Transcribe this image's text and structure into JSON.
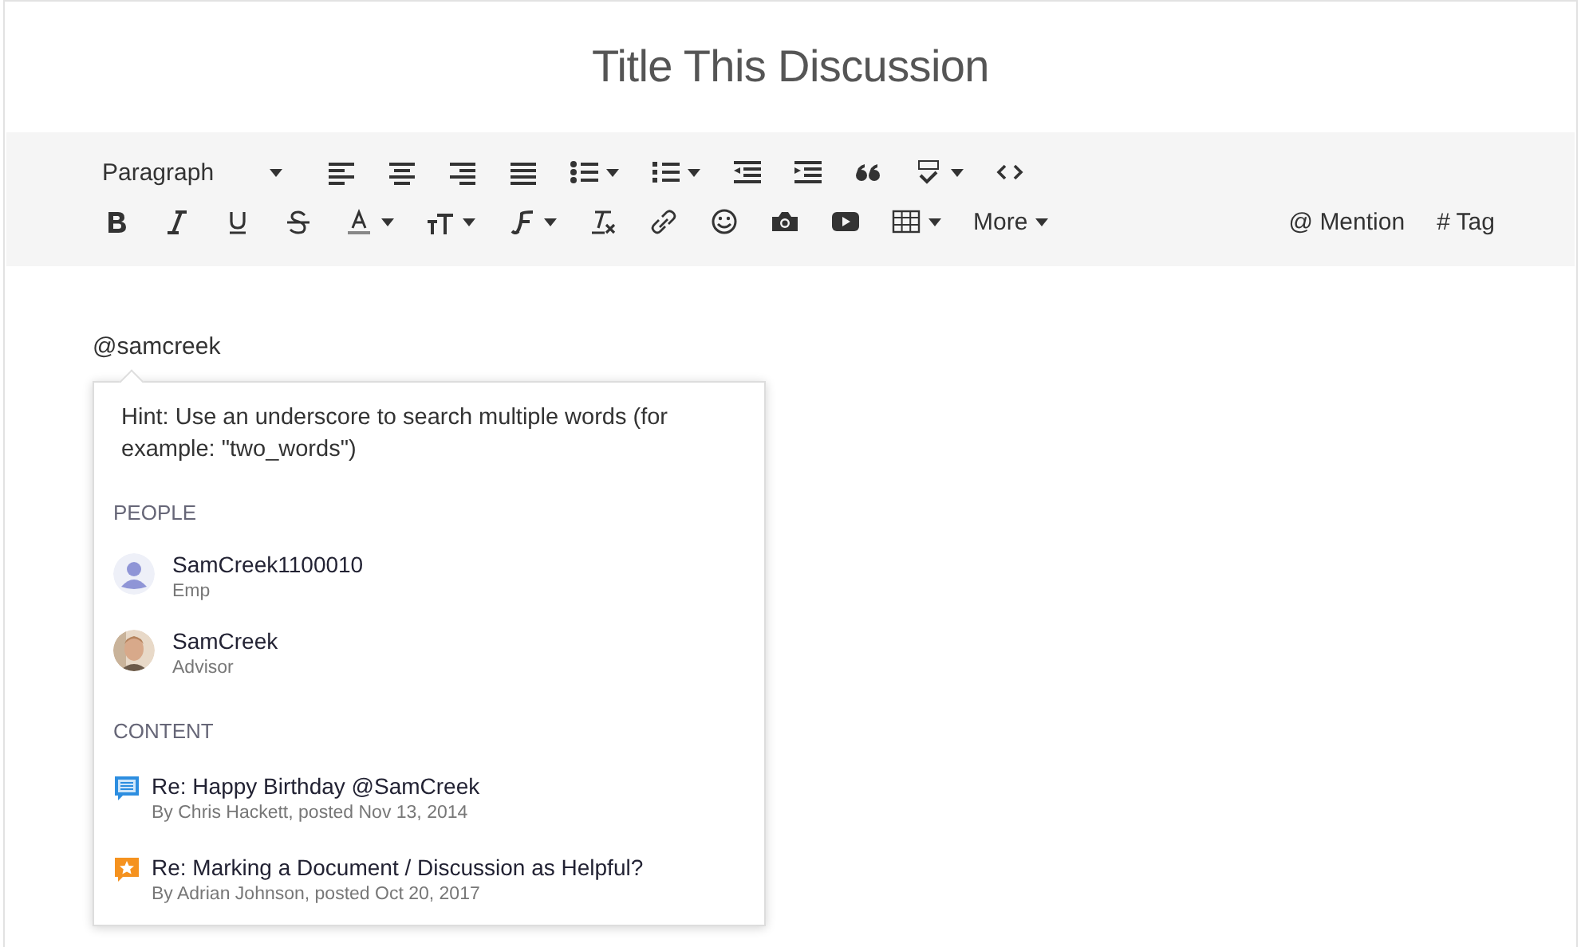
{
  "title": "Title This Discussion",
  "toolbar": {
    "rows": [
      [
        {
          "kind": "paragraph",
          "label": "Paragraph",
          "dropdown": true
        },
        {
          "kind": "align-left",
          "dropdown": false
        },
        {
          "kind": "align-center",
          "dropdown": false
        },
        {
          "kind": "align-right",
          "dropdown": false
        },
        {
          "kind": "justify",
          "dropdown": false
        },
        {
          "kind": "bullet-list",
          "dropdown": true
        },
        {
          "kind": "numbered-list",
          "dropdown": true
        },
        {
          "kind": "outdent",
          "dropdown": false
        },
        {
          "kind": "indent",
          "dropdown": false
        },
        {
          "kind": "quote",
          "dropdown": false
        },
        {
          "kind": "spellcheck",
          "dropdown": true
        },
        {
          "kind": "code",
          "dropdown": false
        }
      ],
      [
        {
          "kind": "bold",
          "dropdown": false
        },
        {
          "kind": "italic",
          "dropdown": false
        },
        {
          "kind": "underline",
          "dropdown": false
        },
        {
          "kind": "strike",
          "dropdown": false
        },
        {
          "kind": "text-color",
          "dropdown": true
        },
        {
          "kind": "font-size",
          "dropdown": true
        },
        {
          "kind": "font-family",
          "dropdown": true
        },
        {
          "kind": "clear-format",
          "dropdown": false
        },
        {
          "kind": "link",
          "dropdown": false
        },
        {
          "kind": "emoji",
          "dropdown": false
        },
        {
          "kind": "camera",
          "dropdown": false
        },
        {
          "kind": "video",
          "dropdown": false
        },
        {
          "kind": "table",
          "dropdown": true
        },
        {
          "kind": "more",
          "label": "More",
          "dropdown": true
        }
      ]
    ],
    "right_buttons": [
      "@ Mention",
      "# Tag"
    ]
  },
  "editor_text": "@samcreek",
  "popup": {
    "hint": "Hint: Use an underscore to search multiple words (for example: \"two_words\")",
    "people_heading": "PEOPLE",
    "people": [
      {
        "name": "SamCreek1100010",
        "role": "Emp",
        "kind": "default"
      },
      {
        "name": "SamCreek",
        "role": "Advisor"
      }
    ],
    "content_heading": "CONTENT",
    "content": [
      {
        "title": "Re: Happy Birthday @SamCreek",
        "meta": "By Chris Hackett, posted Nov 13, 2014",
        "kind": "discussion"
      },
      {
        "title": "Re: Marking a Document / Discussion as Helpful?",
        "meta": "By Adrian Johnson, posted Oct 20, 2017",
        "kind": "question"
      }
    ]
  }
}
